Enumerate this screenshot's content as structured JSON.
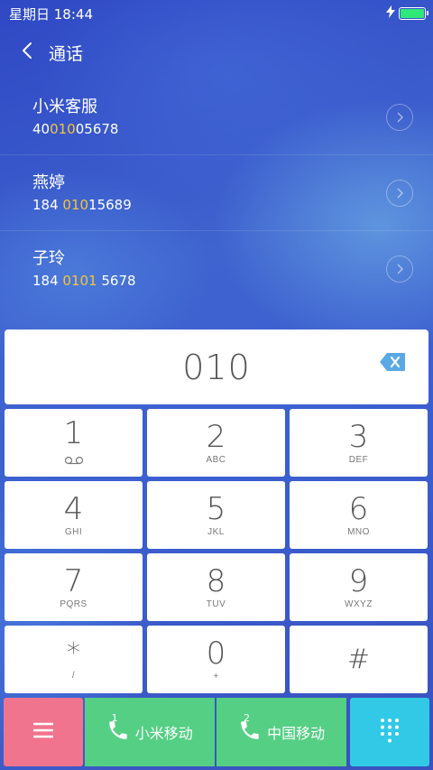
{
  "status_bar": {
    "time": "星期日 18:44"
  },
  "header": {
    "title": "通话"
  },
  "results": [
    {
      "name": "小米客服",
      "number_parts": [
        "40",
        "010",
        "05678"
      ],
      "highlight_index": 1
    },
    {
      "name": "燕婷",
      "number_parts": [
        "184 ",
        "010",
        "15689"
      ],
      "highlight_index": 1
    },
    {
      "name": "子玲",
      "number_parts": [
        "184 ",
        "0101",
        " 5678"
      ],
      "highlight_index": 1
    }
  ],
  "dialer": {
    "input": "010"
  },
  "keypad": [
    {
      "digit": "1",
      "letters": ""
    },
    {
      "digit": "2",
      "letters": "ABC"
    },
    {
      "digit": "3",
      "letters": "DEF"
    },
    {
      "digit": "4",
      "letters": "GHI"
    },
    {
      "digit": "5",
      "letters": "JKL"
    },
    {
      "digit": "6",
      "letters": "MNO"
    },
    {
      "digit": "7",
      "letters": "PQRS"
    },
    {
      "digit": "8",
      "letters": "TUV"
    },
    {
      "digit": "9",
      "letters": "WXYZ"
    },
    {
      "digit": "*",
      "letters": "/"
    },
    {
      "digit": "0",
      "letters": "+"
    },
    {
      "digit": "#",
      "letters": ""
    }
  ],
  "bottom_bar": {
    "sim1": {
      "number": "1",
      "label": "小米移动"
    },
    "sim2": {
      "number": "2",
      "label": "中国移动"
    }
  },
  "colors": {
    "highlight": "#f5c43c",
    "menu": "#f0748e",
    "call": "#55cf84",
    "keypad_toggle": "#32c9e6",
    "backspace": "#5aa9e6",
    "battery": "#2ee878"
  },
  "icons": {
    "back": "chevron-left-icon",
    "detail": "chevron-right-icon",
    "backspace": "backspace-icon",
    "voicemail": "voicemail-icon",
    "menu": "menu-icon",
    "phone": "phone-icon",
    "keypad": "keypad-grid-icon",
    "charging": "charging-icon",
    "battery": "battery-icon"
  }
}
